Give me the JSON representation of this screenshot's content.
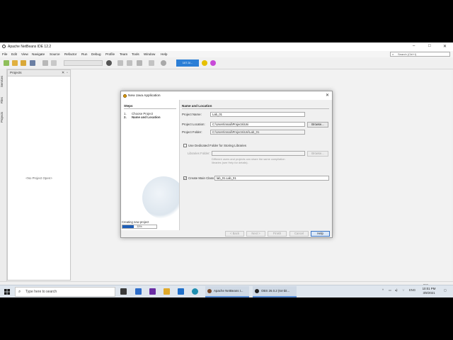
{
  "window": {
    "title": "Apache NetBeans IDE 12.2"
  },
  "menu": [
    "File",
    "Edit",
    "View",
    "Navigate",
    "Source",
    "Refactor",
    "Run",
    "Debug",
    "Profile",
    "Team",
    "Tools",
    "Window",
    "Help"
  ],
  "search": {
    "placeholder": "Search (Ctrl+I)"
  },
  "toolbar": {
    "perf_label": "107.3/..."
  },
  "side_tabs": [
    "Services",
    "Files",
    "Projects"
  ],
  "projects_panel": {
    "title": "Projects",
    "empty_text": "<No Project Open>"
  },
  "status": {
    "ins": "INS"
  },
  "dialog": {
    "title": "New Java Application",
    "steps_heading": "Steps",
    "steps": [
      {
        "num": "1.",
        "label": "Choose Project"
      },
      {
        "num": "2.",
        "label": "Name and Location"
      }
    ],
    "progress_label": "Creating new project",
    "progress_percent": 33,
    "progress_text": "33%",
    "section_title": "Name and Location",
    "project_name_label": "Project Name:",
    "project_name_value": "Lab_01",
    "project_location_label": "Project Location:",
    "project_location_value": "C:\\Users\\mnali\\Projects\\Uni",
    "browse_label": "Browse...",
    "project_folder_label": "Project Folder:",
    "project_folder_value": "C:\\Users\\mnali\\Projects\\Uni\\Lab_01",
    "use_dedicated_label": "Use Dedicated Folder for Storing Libraries",
    "libraries_folder_label": "Libraries Folder:",
    "libraries_browse_label": "Browse...",
    "libraries_note_1": "Different users and projects can share the same compilation",
    "libraries_note_2": "libraries (see Help for details).",
    "create_main_label": "Create Main Class",
    "create_main_checked": true,
    "main_class_value": "lab_01.Lab_01",
    "buttons": {
      "back": "< Back",
      "next": "Next >",
      "finish": "Finish",
      "cancel": "Cancel",
      "help": "Help"
    }
  },
  "taskbar": {
    "search_placeholder": "Type here to search",
    "netbeans_item": "Apache NetBeans I...",
    "obs_item": "OBS 26.0.2 (64-bit...",
    "lang": "ENG",
    "time": "10:01 PM",
    "date": "3/9/2021"
  },
  "colors": {
    "accent": "#2c7fd6",
    "progress": "#1f5fb8"
  }
}
